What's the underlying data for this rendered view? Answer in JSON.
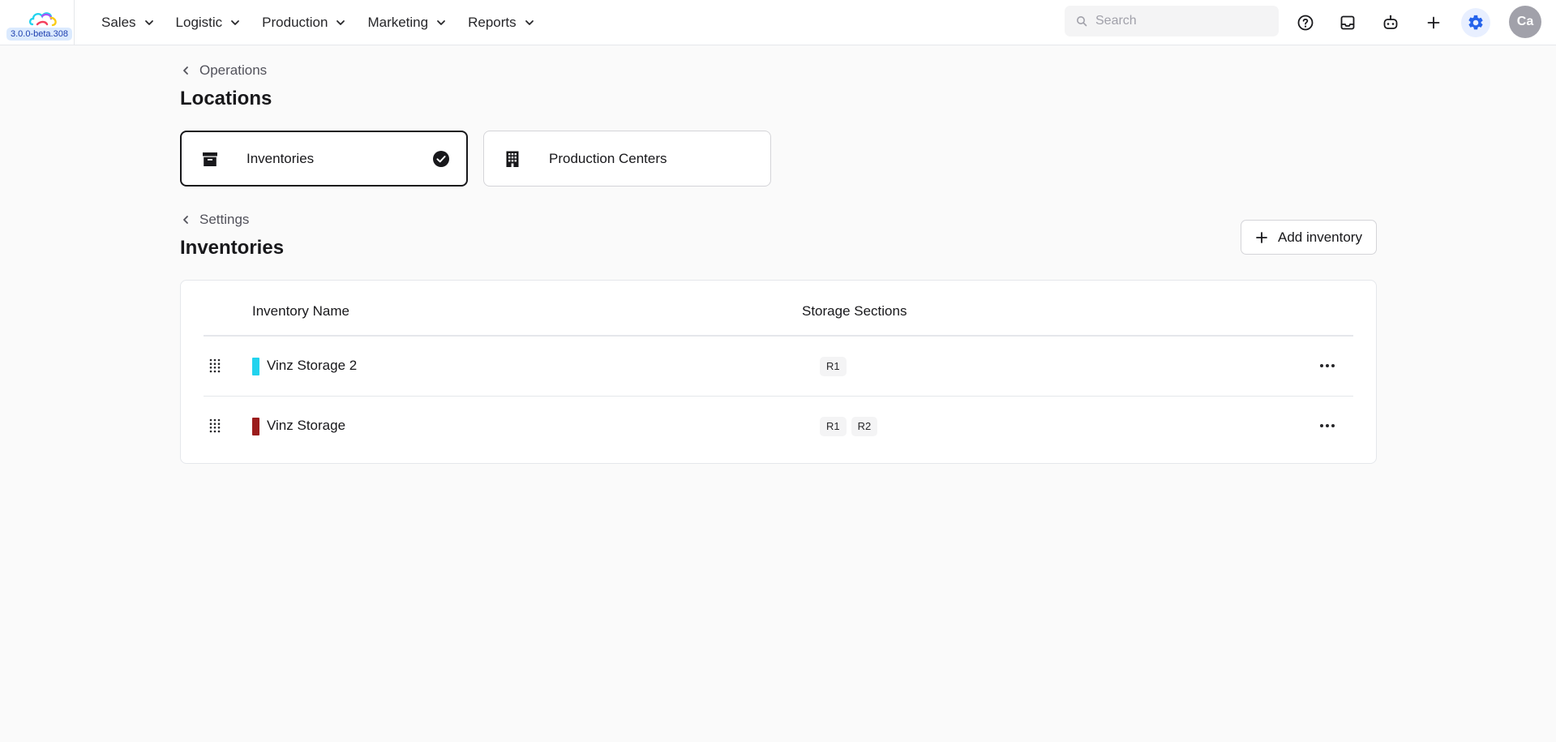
{
  "app": {
    "version": "3.0.0-beta.308",
    "brand_colors": [
      "#22d3ee",
      "#a855f7",
      "#f43f5e",
      "#facc15"
    ]
  },
  "nav": {
    "items": [
      {
        "label": "Sales"
      },
      {
        "label": "Logistic"
      },
      {
        "label": "Production"
      },
      {
        "label": "Marketing"
      },
      {
        "label": "Reports"
      }
    ]
  },
  "search": {
    "placeholder": "Search",
    "value": ""
  },
  "toolbar": {
    "icons": [
      "help-icon",
      "inbox-icon",
      "assistant-bot-icon",
      "plus-icon",
      "settings-gear-icon"
    ],
    "active_icon": "settings-gear-icon",
    "accent": "#2563eb"
  },
  "user": {
    "initials": "Ca"
  },
  "locations": {
    "breadcrumb": "Operations",
    "title": "Locations",
    "cards": [
      {
        "label": "Inventories",
        "icon": "archive-box-icon",
        "selected": true
      },
      {
        "label": "Production Centers",
        "icon": "building-icon",
        "selected": false
      }
    ]
  },
  "inventories": {
    "breadcrumb": "Settings",
    "title": "Inventories",
    "add_label": "Add inventory",
    "columns": {
      "name": "Inventory Name",
      "sections": "Storage Sections"
    },
    "rows": [
      {
        "name": "Vinz Storage 2",
        "color": "#22d3ee",
        "sections": [
          "R1"
        ]
      },
      {
        "name": "Vinz Storage",
        "color": "#9b1c1c",
        "sections": [
          "R1",
          "R2"
        ]
      }
    ]
  }
}
